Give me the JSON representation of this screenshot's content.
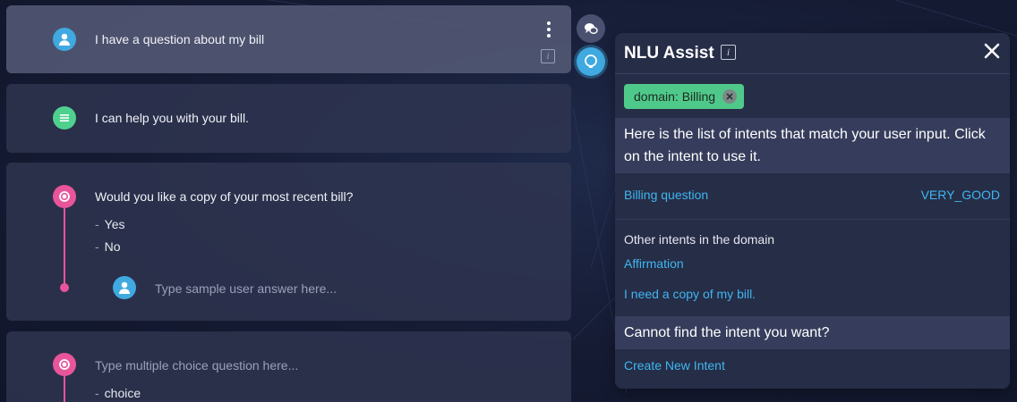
{
  "conversation": {
    "turn1": {
      "text": "I have a question about my bill",
      "info_glyph": "i"
    },
    "turn2": {
      "text": "I can help you with your bill."
    },
    "turn3": {
      "question": "Would you like a copy of your most recent bill?",
      "choices": [
        "Yes",
        "No"
      ],
      "answer_placeholder": "Type sample user answer here..."
    },
    "turn4": {
      "question_placeholder": "Type multiple choice question here...",
      "choices": [
        "choice"
      ]
    }
  },
  "nlu_panel": {
    "title": "NLU Assist",
    "info_glyph": "i",
    "domain_chip": "domain: Billing",
    "instructions": "Here is the list of intents that match your user input. Click on the intent to use it.",
    "top_match": {
      "name": "Billing question",
      "score": "VERY_GOOD"
    },
    "other_label": "Other intents in the domain",
    "other_intents": [
      "Affirmation",
      "I need a copy of my bill."
    ],
    "not_found": "Cannot find the intent you want?",
    "create_link": "Create New Intent"
  },
  "colors": {
    "user_avatar": "#3fa9e0",
    "bot_avatar": "#4fd08f",
    "question_avatar": "#e8559b",
    "link": "#3fb6f0",
    "chip": "#4fc98a"
  },
  "icons": [
    "user-avatar-icon",
    "bot-avatar-icon",
    "question-avatar-icon",
    "kebab-menu-icon",
    "info-icon",
    "chat-bubbles-icon",
    "nlu-assist-icon",
    "close-icon",
    "chip-remove-icon"
  ]
}
